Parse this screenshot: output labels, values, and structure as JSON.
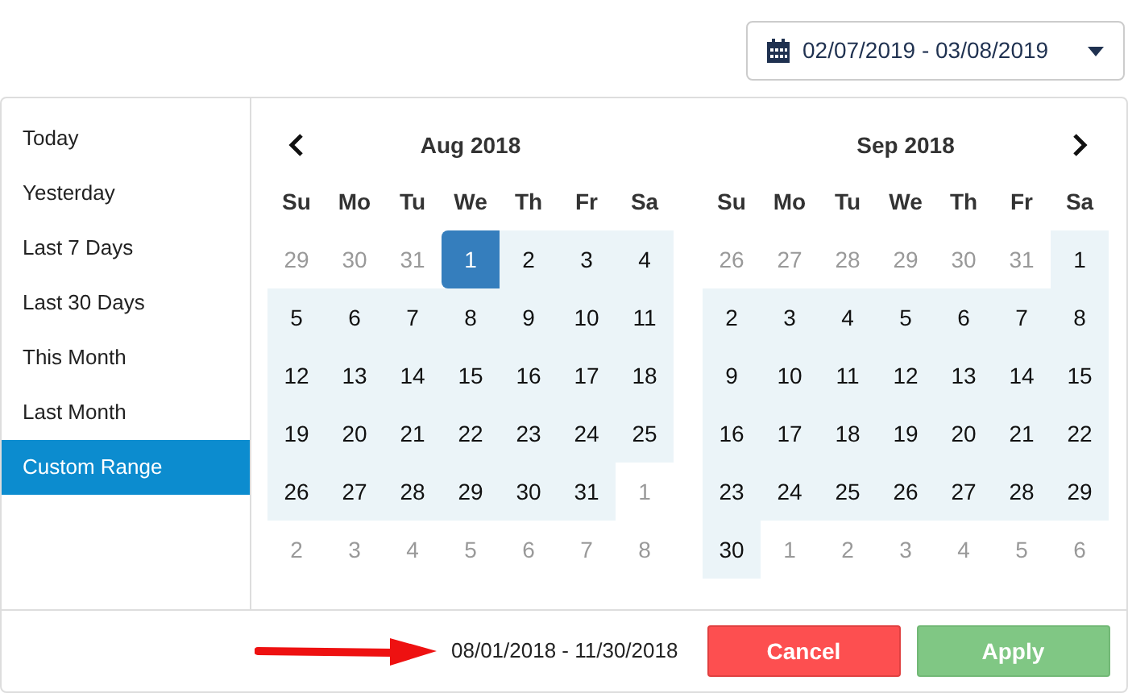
{
  "date_field": {
    "value": "02/07/2019 - 03/08/2019"
  },
  "ranges": [
    {
      "label": "Today",
      "selected": false
    },
    {
      "label": "Yesterday",
      "selected": false
    },
    {
      "label": "Last 7 Days",
      "selected": false
    },
    {
      "label": "Last 30 Days",
      "selected": false
    },
    {
      "label": "This Month",
      "selected": false
    },
    {
      "label": "Last Month",
      "selected": false
    },
    {
      "label": "Custom Range",
      "selected": true
    }
  ],
  "calendars": [
    {
      "title": "Aug 2018",
      "kind": "prev",
      "weekdays": [
        "Su",
        "Mo",
        "Tu",
        "We",
        "Th",
        "Fr",
        "Sa"
      ],
      "weeks": [
        [
          {
            "label": "29",
            "off": true,
            "in_range": false,
            "selected": false
          },
          {
            "label": "30",
            "off": true,
            "in_range": false,
            "selected": false
          },
          {
            "label": "31",
            "off": true,
            "in_range": false,
            "selected": false
          },
          {
            "label": "1",
            "off": false,
            "in_range": true,
            "selected": true
          },
          {
            "label": "2",
            "off": false,
            "in_range": true,
            "selected": false
          },
          {
            "label": "3",
            "off": false,
            "in_range": true,
            "selected": false
          },
          {
            "label": "4",
            "off": false,
            "in_range": true,
            "selected": false
          }
        ],
        [
          {
            "label": "5",
            "off": false,
            "in_range": true,
            "selected": false
          },
          {
            "label": "6",
            "off": false,
            "in_range": true,
            "selected": false
          },
          {
            "label": "7",
            "off": false,
            "in_range": true,
            "selected": false
          },
          {
            "label": "8",
            "off": false,
            "in_range": true,
            "selected": false
          },
          {
            "label": "9",
            "off": false,
            "in_range": true,
            "selected": false
          },
          {
            "label": "10",
            "off": false,
            "in_range": true,
            "selected": false
          },
          {
            "label": "11",
            "off": false,
            "in_range": true,
            "selected": false
          }
        ],
        [
          {
            "label": "12",
            "off": false,
            "in_range": true,
            "selected": false
          },
          {
            "label": "13",
            "off": false,
            "in_range": true,
            "selected": false
          },
          {
            "label": "14",
            "off": false,
            "in_range": true,
            "selected": false
          },
          {
            "label": "15",
            "off": false,
            "in_range": true,
            "selected": false
          },
          {
            "label": "16",
            "off": false,
            "in_range": true,
            "selected": false
          },
          {
            "label": "17",
            "off": false,
            "in_range": true,
            "selected": false
          },
          {
            "label": "18",
            "off": false,
            "in_range": true,
            "selected": false
          }
        ],
        [
          {
            "label": "19",
            "off": false,
            "in_range": true,
            "selected": false
          },
          {
            "label": "20",
            "off": false,
            "in_range": true,
            "selected": false
          },
          {
            "label": "21",
            "off": false,
            "in_range": true,
            "selected": false
          },
          {
            "label": "22",
            "off": false,
            "in_range": true,
            "selected": false
          },
          {
            "label": "23",
            "off": false,
            "in_range": true,
            "selected": false
          },
          {
            "label": "24",
            "off": false,
            "in_range": true,
            "selected": false
          },
          {
            "label": "25",
            "off": false,
            "in_range": true,
            "selected": false
          }
        ],
        [
          {
            "label": "26",
            "off": false,
            "in_range": true,
            "selected": false
          },
          {
            "label": "27",
            "off": false,
            "in_range": true,
            "selected": false
          },
          {
            "label": "28",
            "off": false,
            "in_range": true,
            "selected": false
          },
          {
            "label": "29",
            "off": false,
            "in_range": true,
            "selected": false
          },
          {
            "label": "30",
            "off": false,
            "in_range": true,
            "selected": false
          },
          {
            "label": "31",
            "off": false,
            "in_range": true,
            "selected": false
          },
          {
            "label": "1",
            "off": true,
            "in_range": false,
            "selected": false
          }
        ],
        [
          {
            "label": "2",
            "off": true,
            "in_range": false,
            "selected": false
          },
          {
            "label": "3",
            "off": true,
            "in_range": false,
            "selected": false
          },
          {
            "label": "4",
            "off": true,
            "in_range": false,
            "selected": false
          },
          {
            "label": "5",
            "off": true,
            "in_range": false,
            "selected": false
          },
          {
            "label": "6",
            "off": true,
            "in_range": false,
            "selected": false
          },
          {
            "label": "7",
            "off": true,
            "in_range": false,
            "selected": false
          },
          {
            "label": "8",
            "off": true,
            "in_range": false,
            "selected": false
          }
        ]
      ]
    },
    {
      "title": "Sep 2018",
      "kind": "next",
      "weekdays": [
        "Su",
        "Mo",
        "Tu",
        "We",
        "Th",
        "Fr",
        "Sa"
      ],
      "weeks": [
        [
          {
            "label": "26",
            "off": true,
            "in_range": false,
            "selected": false
          },
          {
            "label": "27",
            "off": true,
            "in_range": false,
            "selected": false
          },
          {
            "label": "28",
            "off": true,
            "in_range": false,
            "selected": false
          },
          {
            "label": "29",
            "off": true,
            "in_range": false,
            "selected": false
          },
          {
            "label": "30",
            "off": true,
            "in_range": false,
            "selected": false
          },
          {
            "label": "31",
            "off": true,
            "in_range": false,
            "selected": false
          },
          {
            "label": "1",
            "off": false,
            "in_range": true,
            "selected": false
          }
        ],
        [
          {
            "label": "2",
            "off": false,
            "in_range": true,
            "selected": false
          },
          {
            "label": "3",
            "off": false,
            "in_range": true,
            "selected": false
          },
          {
            "label": "4",
            "off": false,
            "in_range": true,
            "selected": false
          },
          {
            "label": "5",
            "off": false,
            "in_range": true,
            "selected": false
          },
          {
            "label": "6",
            "off": false,
            "in_range": true,
            "selected": false
          },
          {
            "label": "7",
            "off": false,
            "in_range": true,
            "selected": false
          },
          {
            "label": "8",
            "off": false,
            "in_range": true,
            "selected": false
          }
        ],
        [
          {
            "label": "9",
            "off": false,
            "in_range": true,
            "selected": false
          },
          {
            "label": "10",
            "off": false,
            "in_range": true,
            "selected": false
          },
          {
            "label": "11",
            "off": false,
            "in_range": true,
            "selected": false
          },
          {
            "label": "12",
            "off": false,
            "in_range": true,
            "selected": false
          },
          {
            "label": "13",
            "off": false,
            "in_range": true,
            "selected": false
          },
          {
            "label": "14",
            "off": false,
            "in_range": true,
            "selected": false
          },
          {
            "label": "15",
            "off": false,
            "in_range": true,
            "selected": false
          }
        ],
        [
          {
            "label": "16",
            "off": false,
            "in_range": true,
            "selected": false
          },
          {
            "label": "17",
            "off": false,
            "in_range": true,
            "selected": false
          },
          {
            "label": "18",
            "off": false,
            "in_range": true,
            "selected": false
          },
          {
            "label": "19",
            "off": false,
            "in_range": true,
            "selected": false
          },
          {
            "label": "20",
            "off": false,
            "in_range": true,
            "selected": false
          },
          {
            "label": "21",
            "off": false,
            "in_range": true,
            "selected": false
          },
          {
            "label": "22",
            "off": false,
            "in_range": true,
            "selected": false
          }
        ],
        [
          {
            "label": "23",
            "off": false,
            "in_range": true,
            "selected": false
          },
          {
            "label": "24",
            "off": false,
            "in_range": true,
            "selected": false
          },
          {
            "label": "25",
            "off": false,
            "in_range": true,
            "selected": false
          },
          {
            "label": "26",
            "off": false,
            "in_range": true,
            "selected": false
          },
          {
            "label": "27",
            "off": false,
            "in_range": true,
            "selected": false
          },
          {
            "label": "28",
            "off": false,
            "in_range": true,
            "selected": false
          },
          {
            "label": "29",
            "off": false,
            "in_range": true,
            "selected": false
          }
        ],
        [
          {
            "label": "30",
            "off": false,
            "in_range": true,
            "selected": false
          },
          {
            "label": "1",
            "off": true,
            "in_range": false,
            "selected": false
          },
          {
            "label": "2",
            "off": true,
            "in_range": false,
            "selected": false
          },
          {
            "label": "3",
            "off": true,
            "in_range": false,
            "selected": false
          },
          {
            "label": "4",
            "off": true,
            "in_range": false,
            "selected": false
          },
          {
            "label": "5",
            "off": true,
            "in_range": false,
            "selected": false
          },
          {
            "label": "6",
            "off": true,
            "in_range": false,
            "selected": false
          }
        ]
      ]
    }
  ],
  "footer": {
    "range_text": "08/01/2018 - 11/30/2018",
    "buttons": [
      {
        "label": "Cancel",
        "kind": "cancel"
      },
      {
        "label": "Apply",
        "kind": "apply"
      }
    ]
  }
}
